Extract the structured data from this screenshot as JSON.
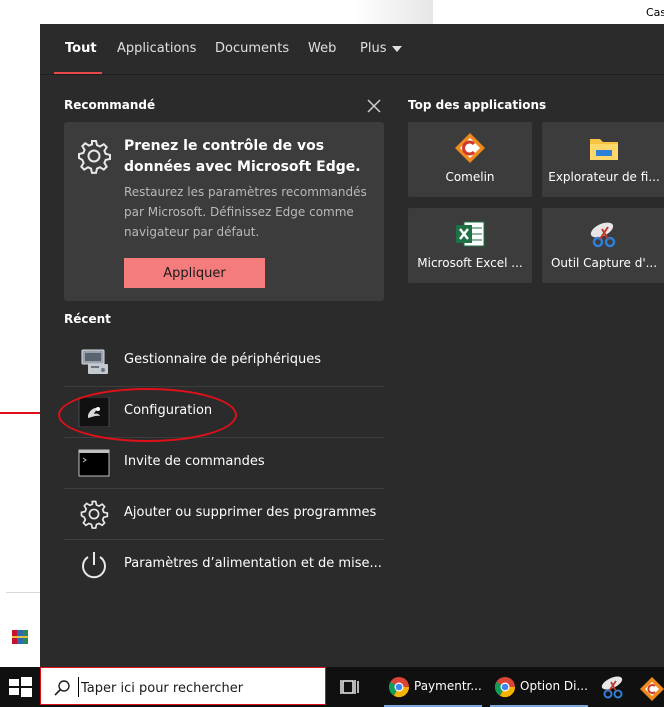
{
  "background": {
    "top_right_text": "Cas"
  },
  "tabs": [
    {
      "label": "Tout",
      "active": true
    },
    {
      "label": "Applications",
      "active": false
    },
    {
      "label": "Documents",
      "active": false
    },
    {
      "label": "Web",
      "active": false
    },
    {
      "label": "Plus",
      "active": false
    }
  ],
  "recommended": {
    "heading": "Recommandé",
    "card": {
      "title": "Prenez le contrôle de vos données avec Microsoft Edge.",
      "description": "Restaurez les paramètres recommandés par Microsoft. Définissez Edge comme navigateur par défaut.",
      "button_label": "Appliquer",
      "icon": "gear-icon"
    }
  },
  "recent": {
    "heading": "Récent",
    "items": [
      {
        "label": "Gestionnaire de périphériques",
        "icon": "device-manager-icon"
      },
      {
        "label": "Configuration",
        "icon": "configuration-app-icon"
      },
      {
        "label": "Invite de commandes",
        "icon": "command-prompt-icon"
      },
      {
        "label": "Ajouter ou supprimer des programmes",
        "icon": "gear-icon"
      },
      {
        "label": "Paramètres d’alimentation et de mise...",
        "icon": "power-icon"
      }
    ]
  },
  "top_apps": {
    "heading": "Top des applications",
    "items": [
      {
        "label": "Comelin",
        "icon": "comelin-icon"
      },
      {
        "label": "Explorateur de fi...",
        "icon": "folder-icon"
      },
      {
        "label": "Microsoft Excel ...",
        "icon": "excel-icon"
      },
      {
        "label": "Outil Capture d'...",
        "icon": "snipping-tool-icon"
      }
    ]
  },
  "taskbar": {
    "search_placeholder": "Taper ici pour rechercher",
    "items": [
      {
        "label": "Paymentr...",
        "icon": "chrome-icon"
      },
      {
        "label": "Option Di...",
        "icon": "chrome-icon"
      }
    ]
  },
  "colors": {
    "panel_bg": "#2b2b2b",
    "card_bg": "#3c3c3c",
    "accent": "#e84a4a",
    "button": "#f47c7c",
    "annotation": "#e0101a"
  }
}
